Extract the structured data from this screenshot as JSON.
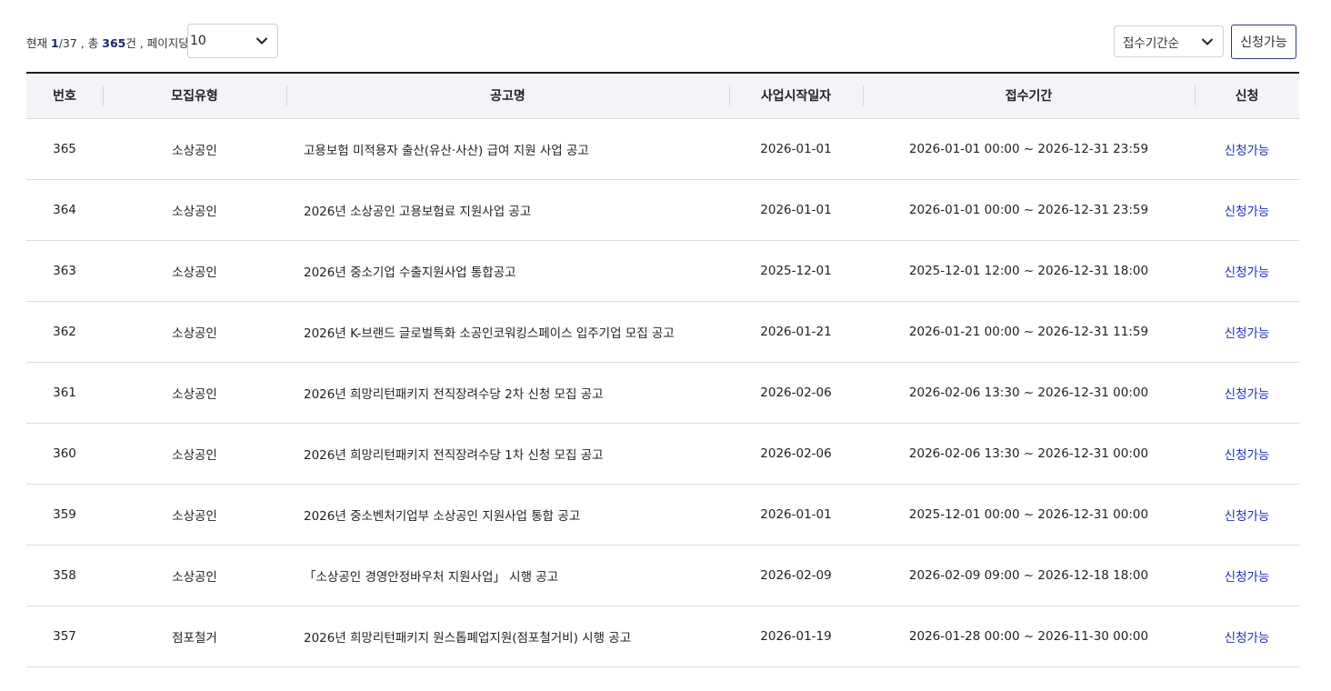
{
  "summary": {
    "current_label": "현재",
    "current_page": "1",
    "total_pages": "/37",
    "total_label": ", 총",
    "total_count": "365",
    "count_unit": "건",
    "per_page_label": ", 페이지당 :"
  },
  "per_page": {
    "selected": "10"
  },
  "sort": {
    "selected": "접수기간순"
  },
  "filter_button": {
    "label": "신청가능"
  },
  "table": {
    "columns": [
      "번호",
      "모집유형",
      "공고명",
      "사업시작일자",
      "접수기간",
      "신청"
    ],
    "rows": [
      [
        "365",
        "소상공인",
        "고용보험 미적용자 출산(유산·사산) 급여 지원 사업 공고",
        "2026-01-01",
        "2026-01-01 00:00 ~ 2026-12-31 23:59",
        "신청가능"
      ],
      [
        "364",
        "소상공인",
        "2026년 소상공인 고용보험료 지원사업 공고",
        "2026-01-01",
        "2026-01-01 00:00 ~ 2026-12-31 23:59",
        "신청가능"
      ],
      [
        "363",
        "소상공인",
        "2026년 중소기업 수출지원사업 통합공고",
        "2025-12-01",
        "2025-12-01 12:00 ~ 2026-12-31 18:00",
        "신청가능"
      ],
      [
        "362",
        "소상공인",
        "2026년 K-브랜드 글로벌특화 소공인코워킹스페이스 입주기업 모집 공고",
        "2026-01-21",
        "2026-01-21 00:00 ~ 2026-12-31 11:59",
        "신청가능"
      ],
      [
        "361",
        "소상공인",
        "2026년 희망리턴패키지 전직장려수당 2차 신청 모집 공고",
        "2026-02-06",
        "2026-02-06 13:30 ~ 2026-12-31 00:00",
        "신청가능"
      ],
      [
        "360",
        "소상공인",
        "2026년 희망리턴패키지 전직장려수당 1차 신청 모집 공고",
        "2026-02-06",
        "2026-02-06 13:30 ~ 2026-12-31 00:00",
        "신청가능"
      ],
      [
        "359",
        "소상공인",
        "2026년 중소벤처기업부 소상공인 지원사업 통합 공고",
        "2026-01-01",
        "2025-12-01 00:00 ~ 2026-12-31 00:00",
        "신청가능"
      ],
      [
        "358",
        "소상공인",
        "「소상공인 경영안정바우처 지원사업」 시행 공고",
        "2026-02-09",
        "2026-02-09 09:00 ~ 2026-12-18 18:00",
        "신청가능"
      ],
      [
        "357",
        "점포철거",
        "2026년 희망리턴패키지 원스톱폐업지원(점포철거비) 시행 공고",
        "2026-01-19",
        "2026-01-28 00:00 ~ 2026-11-30 00:00",
        "신청가능"
      ]
    ]
  }
}
